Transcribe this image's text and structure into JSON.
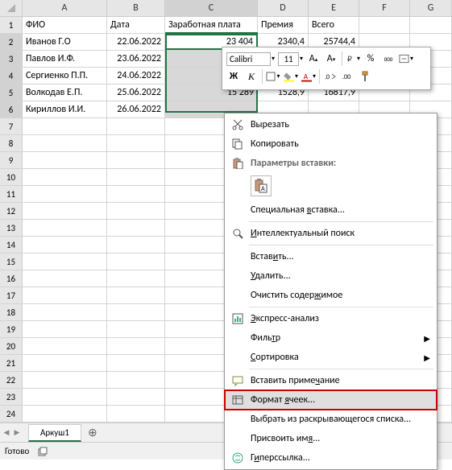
{
  "columns": [
    "A",
    "B",
    "C",
    "D",
    "E",
    "F",
    "G"
  ],
  "headersRow": {
    "a": "ФИО",
    "b": "Дата",
    "c": "Заработная плата",
    "d": "Премия",
    "e": "Всего"
  },
  "rows": [
    {
      "num": 2,
      "a": "Иванов Г.О",
      "b": "22.06.2022",
      "c": "23 404",
      "d": "2340,4",
      "e": "25744,4"
    },
    {
      "num": 3,
      "a": "Павлов И.Ф.",
      "b": "23.06.2022",
      "c": "",
      "d": "",
      "e": ""
    },
    {
      "num": 4,
      "a": "Сергиенко П.П.",
      "b": "24.06.2022",
      "c": "",
      "d": "",
      "e": ""
    },
    {
      "num": 5,
      "a": "Волкодав Е.П.",
      "b": "25.06.2022",
      "c": "15 289",
      "d": "1528,9",
      "e": "16817,9"
    },
    {
      "num": 6,
      "a": "Кириллов И.И.",
      "b": "26.06.2022",
      "c": "",
      "d": "",
      "e": ""
    }
  ],
  "emptyRows": [
    7,
    8,
    9,
    10,
    11,
    12,
    13,
    14,
    15,
    16,
    17,
    18,
    19,
    20,
    21,
    22,
    23,
    24
  ],
  "miniToolbar": {
    "font": "Calibri",
    "size": "11"
  },
  "menu": {
    "cut": "Вырезать",
    "copy": "Копировать",
    "pasteOptionsHeader": "Параметры вставки:",
    "pasteSpecial": "Специальная вставка...",
    "smartLookup": "Интеллектуальный поиск",
    "insert": "Вставить...",
    "delete": "Удалить...",
    "clear": "Очистить содержимое",
    "quickAnalysis": "Экспресс-анализ",
    "filter": "Фильтр",
    "sort": "Сортировка",
    "comment": "Вставить примечание",
    "formatCells": "Формат ячеек...",
    "pickList": "Выбрать из раскрывающегося списка...",
    "defineName": "Присвоить имя...",
    "hyperlink": "Гиперссылка..."
  },
  "sheetTab": "Аркуш1",
  "status": "Готово"
}
